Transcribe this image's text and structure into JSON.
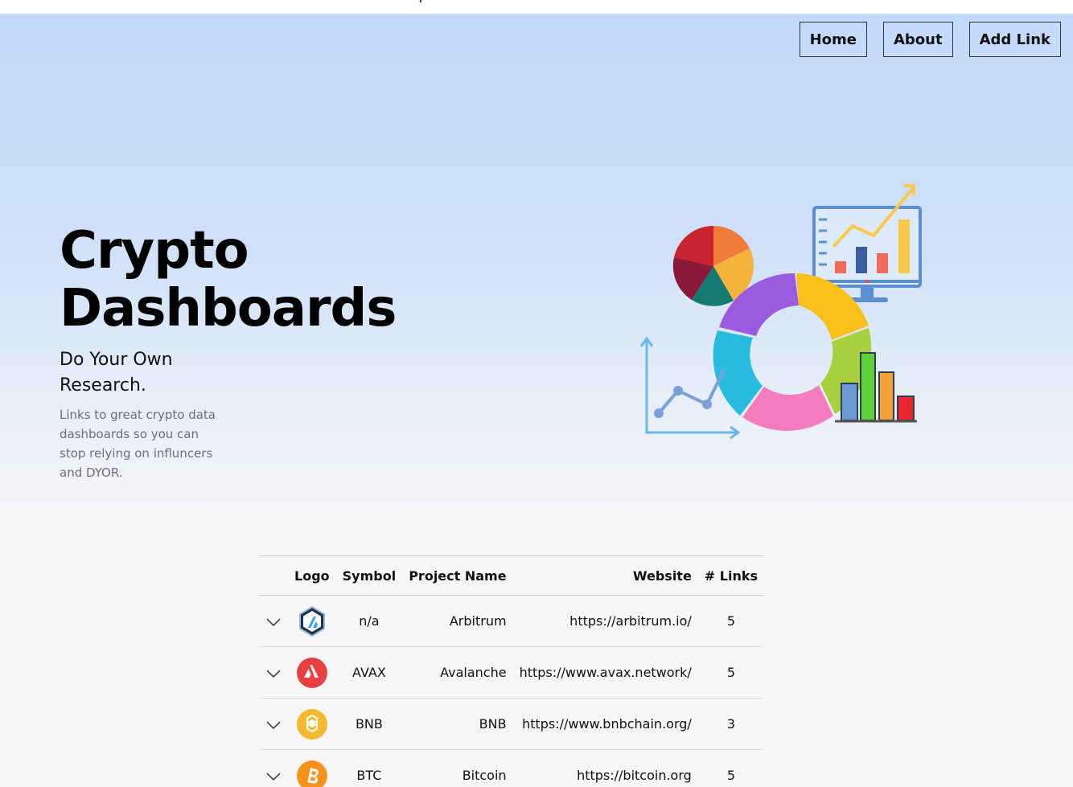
{
  "nav": {
    "home": "Home",
    "about": "About",
    "add_link": "Add Link"
  },
  "hero": {
    "title_line1": "Crypto",
    "title_line2": "Dashboards",
    "tagline": "Do Your Own Research.",
    "description": "Links to great crypto data dashboards so you can stop relying on influncers and DYOR."
  },
  "table": {
    "headers": {
      "expand": "",
      "logo": "Logo",
      "symbol": "Symbol",
      "name": "Project Name",
      "website": "Website",
      "links": "# Links"
    },
    "rows": [
      {
        "logo_icon": "arbitrum-logo-icon",
        "symbol": "n/a",
        "name": "Arbitrum",
        "website": "https://arbitrum.io/",
        "links": "5"
      },
      {
        "logo_icon": "avalanche-logo-icon",
        "symbol": "AVAX",
        "name": "Avalanche",
        "website": "https://www.avax.network/",
        "links": "5"
      },
      {
        "logo_icon": "bnb-logo-icon",
        "symbol": "BNB",
        "name": "BNB",
        "website": "https://www.bnbchain.org/",
        "links": "3"
      },
      {
        "logo_icon": "bitcoin-logo-icon",
        "symbol": "BTC",
        "name": "Bitcoin",
        "website": "https://bitcoin.org",
        "links": "5"
      }
    ]
  },
  "colors": {
    "hero_top": "#c2dafb",
    "page_bg": "#f7f6f8",
    "avalanche_red": "#e84142",
    "bnb_yellow": "#f3ba2f",
    "bitcoin_orange": "#f7931a",
    "arbitrum_blue": "#2d374b"
  }
}
